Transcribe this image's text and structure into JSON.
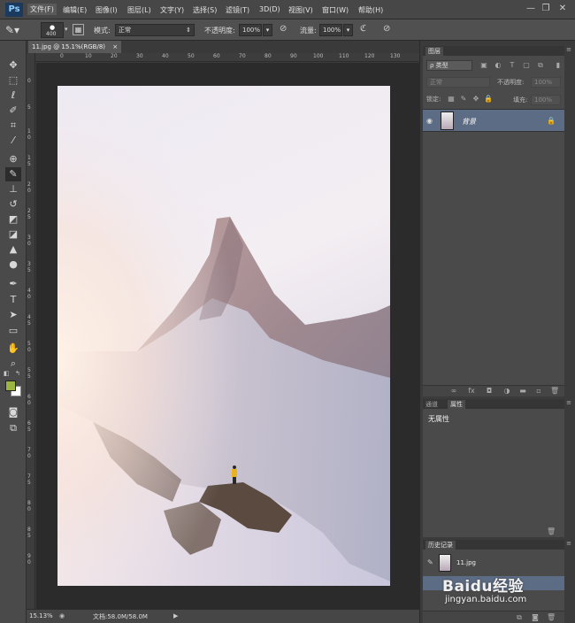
{
  "app": {
    "logo": "Ps"
  },
  "menu": [
    "文件(F)",
    "编辑(E)",
    "图像(I)",
    "图层(L)",
    "文字(Y)",
    "选择(S)",
    "滤镜(T)",
    "3D(D)",
    "视图(V)",
    "窗口(W)",
    "帮助(H)"
  ],
  "window_controls": {
    "minimize": "—",
    "restore": "❐",
    "close": "✕"
  },
  "options": {
    "brush_size": "400",
    "mode_label": "模式:",
    "mode_value": "正常",
    "opacity_label": "不透明度:",
    "opacity_value": "100%",
    "flow_label": "流量:",
    "flow_value": "100%"
  },
  "tools": [
    "move-tool",
    "marquee-tool",
    "lasso-tool",
    "quick-select-tool",
    "crop-tool",
    "eyedropper-tool",
    "healing-tool",
    "brush-tool",
    "stamp-tool",
    "history-brush-tool",
    "eraser-tool",
    "paint-bucket-tool",
    "blur-tool",
    "dodge-tool",
    "pen-tool",
    "type-tool",
    "path-select-tool",
    "rectangle-tool",
    "hand-tool",
    "zoom-tool"
  ],
  "colors": {
    "foreground": "#9ab540",
    "background": "#ffffff",
    "accent_selected_layer": "#5c6c84"
  },
  "document": {
    "tab_title": "11.jpg @ 15.1%(RGB/8)",
    "close": "×",
    "zoom": "15.13%",
    "doc_info": "文档:58.0M/58.0M"
  },
  "ruler": {
    "top": [
      "0",
      "10",
      "20",
      "30",
      "40",
      "50",
      "60",
      "70",
      "80",
      "90",
      "100",
      "110",
      "120",
      "130"
    ],
    "left": [
      "0",
      "5",
      "1\n0",
      "1\n5",
      "2\n0",
      "2\n5",
      "3\n0",
      "3\n5",
      "4\n0",
      "4\n5",
      "5\n0",
      "5\n5",
      "6\n0",
      "6\n5",
      "7\n0",
      "7\n5",
      "8\n0",
      "8\n5",
      "9\n0"
    ]
  },
  "layers_panel": {
    "tab": "图层",
    "filter_label": "ρ 类型",
    "blend_mode": "正常",
    "opacity_label": "不透明度:",
    "opacity_value": "100%",
    "lock_label": "锁定:",
    "fill_label": "填充:",
    "fill_value": "100%",
    "layers": [
      {
        "name": "背景",
        "visible": true,
        "locked": true
      }
    ]
  },
  "properties_panel": {
    "tabs": [
      "通道",
      "属性"
    ],
    "active_tab": "属性",
    "content": "无属性"
  },
  "history_panel": {
    "tab": "历史记录",
    "items": [
      "11.jpg"
    ]
  },
  "watermark": {
    "brand": "Baidu经验",
    "url": "jingyan.baidu.com"
  }
}
